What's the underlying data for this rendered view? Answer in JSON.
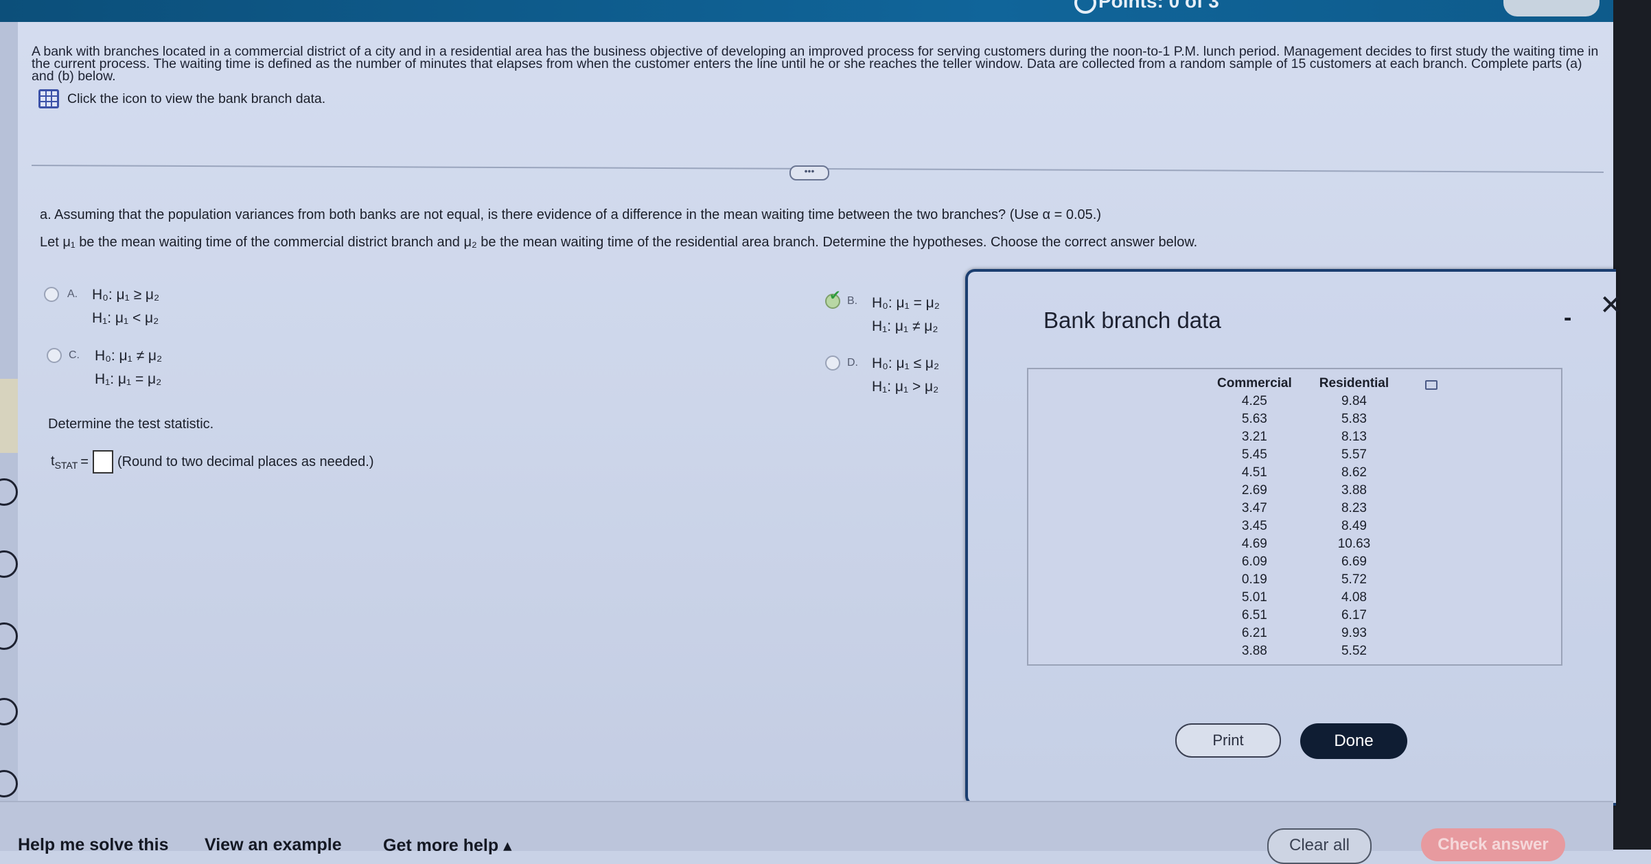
{
  "header": {
    "points_label": "Points: 0 of 3"
  },
  "intro_text": "A bank with branches located in a commercial district of a city and in a residential area has the business objective of developing an improved process for serving customers during the noon-to-1 P.M. lunch period. Management decides to first study the waiting time in the current process. The waiting time is defined as the number of minutes that elapses from when the customer enters the line until he or she reaches the teller window. Data are collected from a random sample of 15 customers at each branch. Complete parts (a) and (b) below.",
  "data_link": "Click the icon to view the bank branch data.",
  "more_button": "•••",
  "part_a": {
    "question": "a. Assuming that the population variances from both banks are not equal, is there evidence of a difference in the mean waiting time between the two branches? (Use α = 0.05.)",
    "let_text": "Let μ₁ be the mean waiting time of the commercial district branch and μ₂ be the mean waiting time of the residential area branch. Determine the hypotheses. Choose the correct answer below.",
    "choices": [
      {
        "letter": "A.",
        "h0": "H₀: μ₁ ≥ μ₂",
        "h1": "H₁: μ₁ < μ₂",
        "selected": false
      },
      {
        "letter": "B.",
        "h0": "H₀: μ₁ = μ₂",
        "h1": "H₁: μ₁ ≠ μ₂",
        "selected": true
      },
      {
        "letter": "C.",
        "h0": "H₀: μ₁ ≠ μ₂",
        "h1": "H₁: μ₁ = μ₂",
        "selected": false
      },
      {
        "letter": "D.",
        "h0": "H₀: μ₁ ≤ μ₂",
        "h1": "H₁: μ₁ > μ₂",
        "selected": false
      }
    ],
    "determine_label": "Determine the test statistic.",
    "tstat_prefix": "t",
    "tstat_sub": "STAT",
    "tstat_eq": "=",
    "tstat_hint": "(Round to two decimal places as needed.)"
  },
  "modal": {
    "title": "Bank branch data",
    "columns": [
      "Commercial",
      "Residential"
    ],
    "rows": [
      [
        "4.25",
        "9.84"
      ],
      [
        "5.63",
        "5.83"
      ],
      [
        "3.21",
        "8.13"
      ],
      [
        "5.45",
        "5.57"
      ],
      [
        "4.51",
        "8.62"
      ],
      [
        "2.69",
        "3.88"
      ],
      [
        "3.47",
        "8.23"
      ],
      [
        "3.45",
        "8.49"
      ],
      [
        "4.69",
        "10.63"
      ],
      [
        "6.09",
        "6.69"
      ],
      [
        "0.19",
        "5.72"
      ],
      [
        "5.01",
        "4.08"
      ],
      [
        "6.51",
        "6.17"
      ],
      [
        "6.21",
        "9.93"
      ],
      [
        "3.88",
        "5.52"
      ]
    ],
    "print_label": "Print",
    "done_label": "Done",
    "minimize_glyph": "-",
    "close_glyph": "✕"
  },
  "bottom": {
    "help_label": "Help me solve this",
    "example_label": "View an example",
    "more_help_label": "Get more help ▴",
    "clear_label": "Clear all",
    "check_label": "Check answer"
  },
  "colors": {
    "topbar": "#10659a",
    "done_button": "#0f1d33",
    "check_button": "#e79a9f",
    "selected_check": "#2e9b3d"
  }
}
